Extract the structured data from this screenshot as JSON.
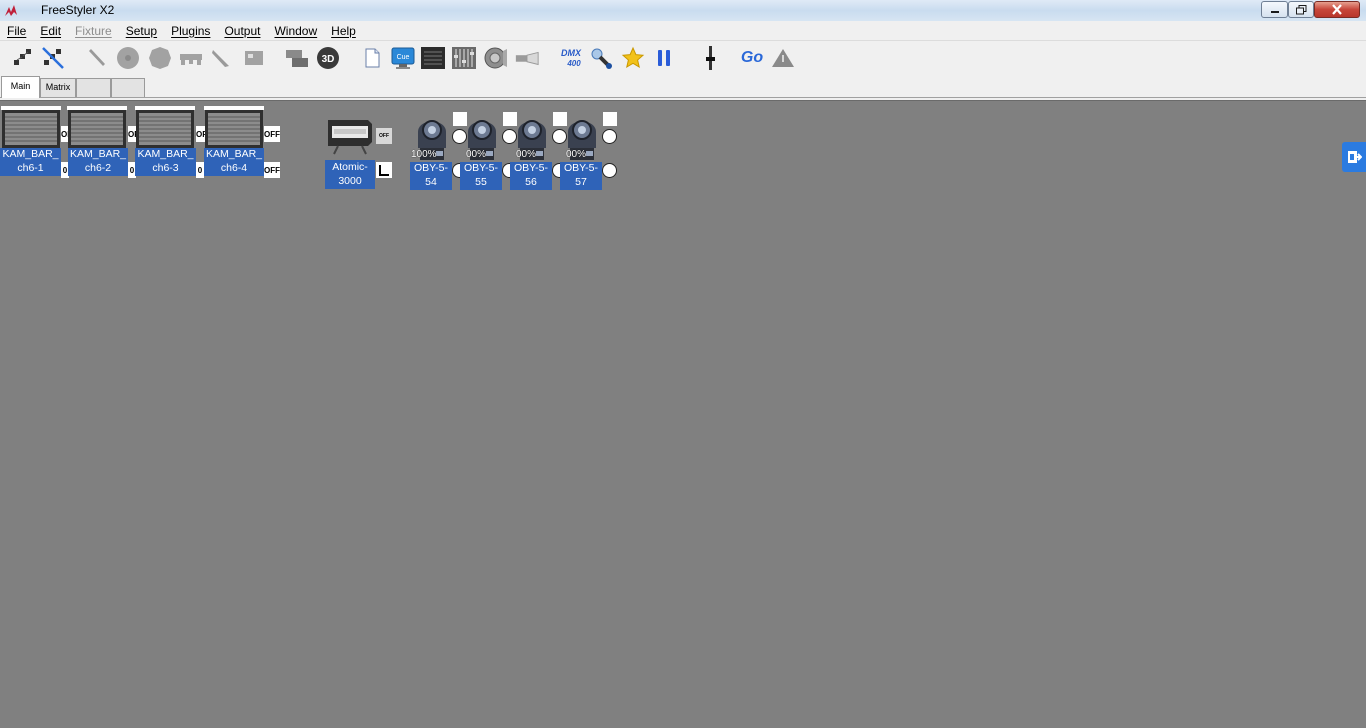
{
  "window": {
    "title": "FreeStyler X2",
    "controls": {
      "minimize": "minimize-icon",
      "maximize": "maximize-icon",
      "close": "close-icon"
    }
  },
  "menu": [
    {
      "label": "File",
      "enabled": true
    },
    {
      "label": "Edit",
      "enabled": true
    },
    {
      "label": "Fixture",
      "enabled": false
    },
    {
      "label": "Setup",
      "enabled": true
    },
    {
      "label": "Plugins",
      "enabled": true
    },
    {
      "label": "Output",
      "enabled": true
    },
    {
      "label": "Window",
      "enabled": true
    },
    {
      "label": "Help",
      "enabled": true
    }
  ],
  "toolbar": {
    "dmx_label_top": "DMX",
    "dmx_label_bottom": "400",
    "cue_label": "Cue",
    "threed_label": "3D",
    "go_label": "Go",
    "icons": [
      "select-group-icon",
      "deselect-icon",
      "strobe-icon",
      "gobo-wheel-icon",
      "color-wheel-icon",
      "pan-tilt-icon",
      "beam-icon",
      "shutter-icon",
      "overlay-icon",
      "3d-view-icon",
      "new-page-icon",
      "cue-monitor-icon",
      "console-icon",
      "faders-icon",
      "speaker-icon",
      "smoke-icon",
      "dmx400-icon",
      "spotlight-icon",
      "star-icon",
      "pause-icon",
      "fader-icon",
      "go-icon",
      "warning-icon"
    ]
  },
  "tabs": [
    {
      "label": "Main",
      "active": true
    },
    {
      "label": "Matrix",
      "active": false
    },
    {
      "label": "",
      "active": false
    },
    {
      "label": "",
      "active": false
    }
  ],
  "fixtures": {
    "bars": [
      {
        "line1": "KAM_BAR_",
        "line2": "ch6-1",
        "state": "OFF",
        "dim": "0"
      },
      {
        "line1": "KAM_BAR_",
        "line2": "ch6-2",
        "state": "OFF",
        "dim": "0"
      },
      {
        "line1": "KAM_BAR_",
        "line2": "ch6-3",
        "state": "OFF",
        "dim": "0"
      },
      {
        "line1": "KAM_BAR_",
        "line2": "ch6-4",
        "state": "OFF",
        "dim": "0"
      }
    ],
    "strobe": {
      "line1": "Atomic-",
      "line2": "3000",
      "state": "OFF"
    },
    "heads": [
      {
        "line1": "OBY-5-",
        "line2": "54",
        "dimmer": "100%"
      },
      {
        "line1": "OBY-5-",
        "line2": "55",
        "dimmer": "00%"
      },
      {
        "line1": "OBY-5-",
        "line2": "56",
        "dimmer": "00%"
      },
      {
        "line1": "OBY-5-",
        "line2": "57",
        "dimmer": "00%"
      }
    ]
  },
  "colors": {
    "label_bg": "#2f63b8",
    "workspace": "#808080",
    "accent": "#2b7be0"
  }
}
